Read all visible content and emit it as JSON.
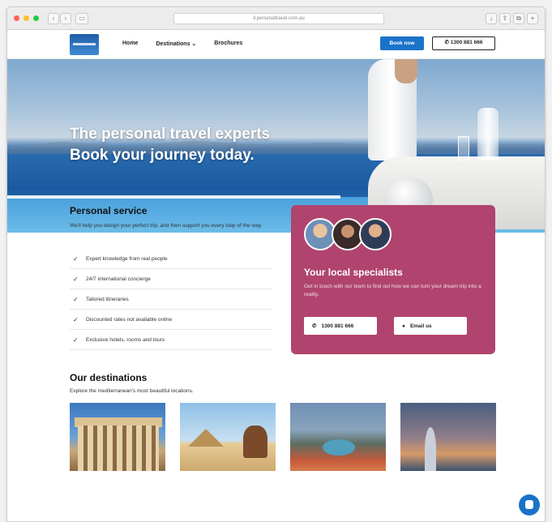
{
  "browser": {
    "url": "ll.personaltravel.com.au",
    "colors": {
      "close": "#ff5f57",
      "minimize": "#ffbd2e",
      "maximize": "#28c840"
    }
  },
  "header": {
    "nav": [
      "Home",
      "Destinations ⌄",
      "Brochures"
    ],
    "book_label": "Book now",
    "phone_label": "1300 881 666",
    "accent": "#1a73c9"
  },
  "hero": {
    "title": "The personal travel experts",
    "subtitle": "Book your journey today."
  },
  "personal_service": {
    "title": "Personal service",
    "text": "We'll help you design your perfect trip, and then support you every step of the way.",
    "items": [
      "Expert knowledge from real people",
      "24/7 international concierge",
      "Tailored itineraries",
      "Discounted rates not available online",
      "Exclusive hotels, rooms and tours"
    ]
  },
  "specialists": {
    "title": "Your local specialists",
    "text": "Get in touch with our team to find out how we can turn your dream trip into a reality.",
    "phone_button": "1300 881 666",
    "email_button": "Email us",
    "card_color": "#b0446e"
  },
  "destinations": {
    "title": "Our destinations",
    "text": "Explore the mediterranean's most beautiful locations."
  }
}
